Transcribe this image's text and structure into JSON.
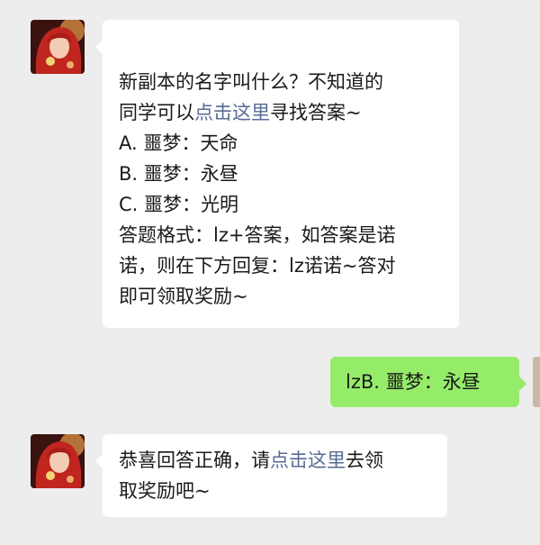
{
  "chat": {
    "messages": [
      {
        "sender": "other",
        "lines": [
          {
            "text": "新副本的名字叫什么？不知道的"
          },
          {
            "pre": "同学可以",
            "link": "点击这里",
            "post": "寻找答案~"
          },
          {
            "text": "A. 噩梦：天命"
          },
          {
            "text": "B. 噩梦：永昼"
          },
          {
            "text": "C. 噩梦：光明"
          },
          {
            "text": "答题格式：lz+答案，如答案是诺"
          },
          {
            "text": "诺，则在下方回复：lz诺诺~答对"
          },
          {
            "text": "即可领取奖励~"
          }
        ]
      },
      {
        "sender": "self",
        "text": "lzB. 噩梦：永昼"
      },
      {
        "sender": "other",
        "lines": [
          {
            "pre": "恭喜回答正确，请",
            "link": "点击这里",
            "post": "去领"
          },
          {
            "text": "取奖励吧~"
          }
        ]
      }
    ]
  },
  "colors": {
    "background": "#ededed",
    "bubble_other": "#ffffff",
    "bubble_self": "#95ec69",
    "link": "#576b95"
  },
  "icons": {
    "other_avatar": "red-haired-character-avatar",
    "self_avatar": "user-avatar"
  }
}
